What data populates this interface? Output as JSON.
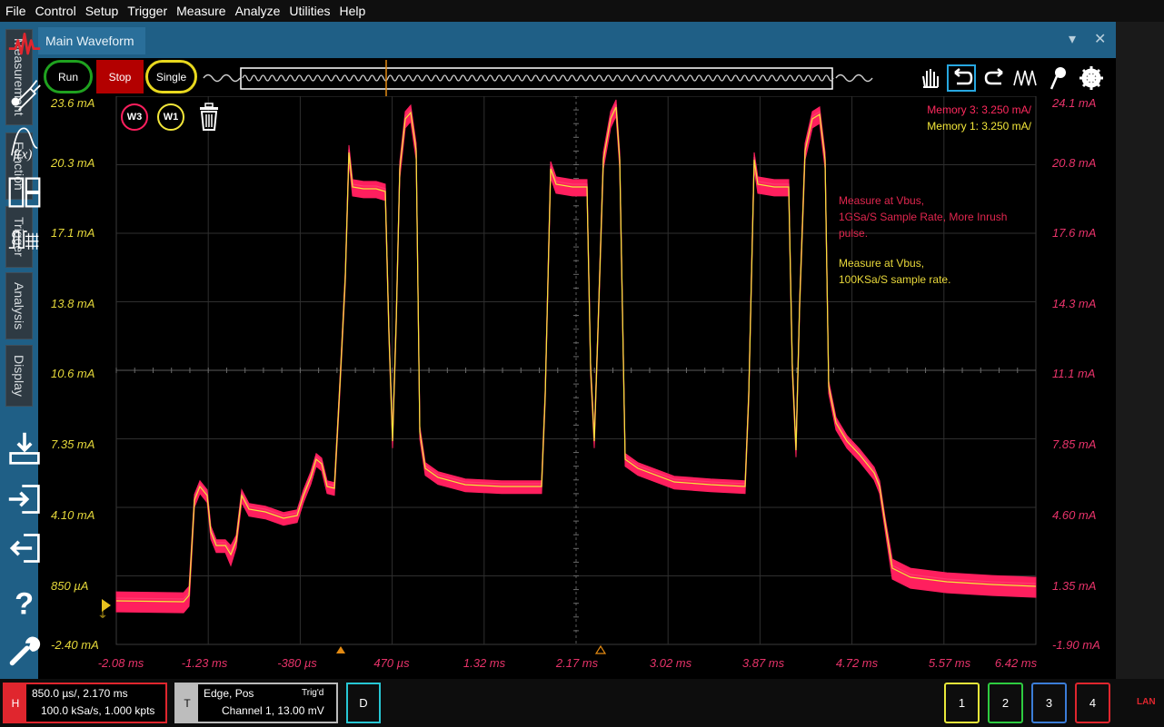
{
  "menu": [
    "File",
    "Control",
    "Setup",
    "Trigger",
    "Measure",
    "Analyze",
    "Utilities",
    "Help"
  ],
  "side_tabs": [
    "Measurement",
    "Function",
    "Trigger",
    "Analysis",
    "Display"
  ],
  "panel": {
    "title": "Main Waveform",
    "dropdown_icon": "chevron-down-icon",
    "close_icon": "close-icon"
  },
  "toolbar": {
    "run": "Run",
    "stop": "Stop",
    "single": "Single"
  },
  "axes": {
    "left_labels": [
      "23.6 mA",
      "20.3 mA",
      "17.1 mA",
      "13.8 mA",
      "10.6 mA",
      "7.35 mA",
      "4.10 mA",
      "850 µA",
      "-2.40 mA"
    ],
    "right_labels": [
      "24.1 mA",
      "20.8 mA",
      "17.6 mA",
      "14.3 mA",
      "11.1 mA",
      "7.85 mA",
      "4.60 mA",
      "1.35 mA",
      "-1.90 mA"
    ],
    "x_labels": [
      "-2.08 ms",
      "-1.23 ms",
      "-380 µs",
      "470 µs",
      "1.32 ms",
      "2.17 ms",
      "3.02 ms",
      "3.87 ms",
      "4.72 ms",
      "5.57 ms",
      "6.42 ms"
    ]
  },
  "waveforms": {
    "w3_badge": "W3",
    "w1_badge": "W1"
  },
  "memory": {
    "line1": "Memory 3:  3.250 mA/",
    "line2": "Memory 1:  3.250 mA/"
  },
  "notes": {
    "red_1": "Measure at Vbus,",
    "red_2": "1GSa/S Sample Rate, More Inrush",
    "red_3": "pulse.",
    "yellow_1": "Measure at Vbus,",
    "yellow_2": "100KSa/S sample rate."
  },
  "status": {
    "horizontal_tag": "H",
    "horizontal_1": "850.0 µs/, 2.170 ms",
    "horizontal_2": "100.0 kSa/s, 1.000 kpts",
    "trigger_tag": "T",
    "trigger_1": "Edge, Pos",
    "trigger_state": "Trig'd",
    "trigger_2": "Channel 1, 13.00 mV",
    "digital": "D",
    "channels": [
      "1",
      "2",
      "3",
      "4"
    ],
    "lan": "LAN"
  },
  "colors": {
    "w3": "#ff1f5e",
    "w1": "#f2e63a",
    "accent": "#1f5f86",
    "ch1": "#e8e83a",
    "ch2": "#2ecc40",
    "ch3": "#3b7dd8",
    "ch4": "#e0262e"
  },
  "icons": {
    "toolbar": [
      "pan-hand-icon",
      "undo-zoom-icon",
      "redo-zoom-icon",
      "waveform-icon",
      "marker-icon",
      "gear-icon"
    ],
    "right": [
      "keysight-logo-icon",
      "probe-icon",
      "function-fx-icon",
      "layout-split-icon",
      "digital-bus-icon",
      "save-download-icon",
      "import-icon",
      "export-icon",
      "help-icon",
      "wrench-icon"
    ]
  }
}
